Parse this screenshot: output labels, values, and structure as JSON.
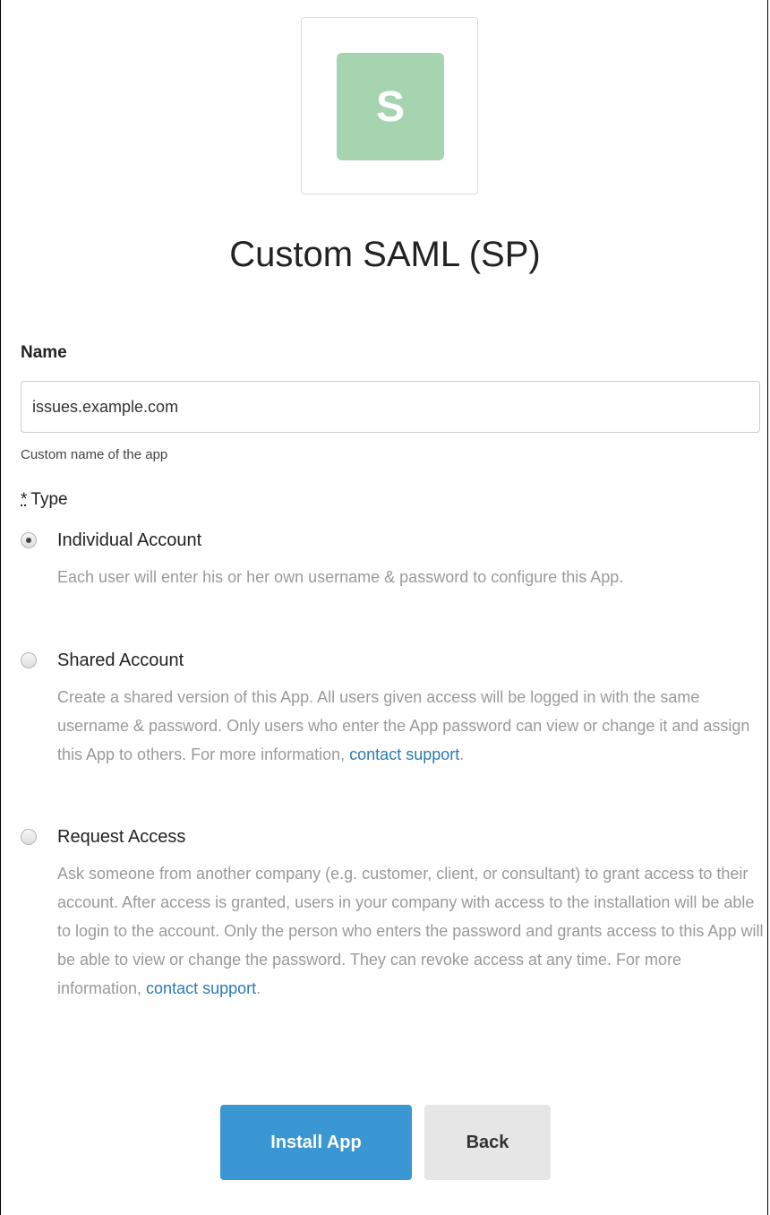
{
  "app": {
    "logo_letter": "S",
    "logo_color": "#a6d4b1",
    "title": "Custom SAML (SP)"
  },
  "form": {
    "name_label": "Name",
    "name_value": "issues.example.com",
    "name_help": "Custom name of the app",
    "type_required_marker": "*",
    "type_label": "Type",
    "options": [
      {
        "title": "Individual Account",
        "selected": true,
        "description": "Each user will enter his or her own username & password to configure this App."
      },
      {
        "title": "Shared Account",
        "selected": false,
        "description": "Create a shared version of this App. All users given access will be logged in with the same username & password. Only users who enter the App password can view or change it and assign this App to others. For more information, ",
        "link_text": "contact support",
        "suffix": "."
      },
      {
        "title": "Request Access",
        "selected": false,
        "description": "Ask someone from another company (e.g. customer, client, or consultant) to grant access to their account. After access is granted, users in your company with access to the installation will be able to login to the account. Only the person who enters the password and grants access to this App will be able to view or change the password. They can revoke access at any time. For more information, ",
        "link_text": "contact support",
        "suffix": "."
      }
    ]
  },
  "buttons": {
    "install_label": "Install App",
    "back_label": "Back"
  },
  "colors": {
    "primary": "#3b97d3",
    "link": "#2a7ab8",
    "secondary_button": "#e6e6e6"
  }
}
